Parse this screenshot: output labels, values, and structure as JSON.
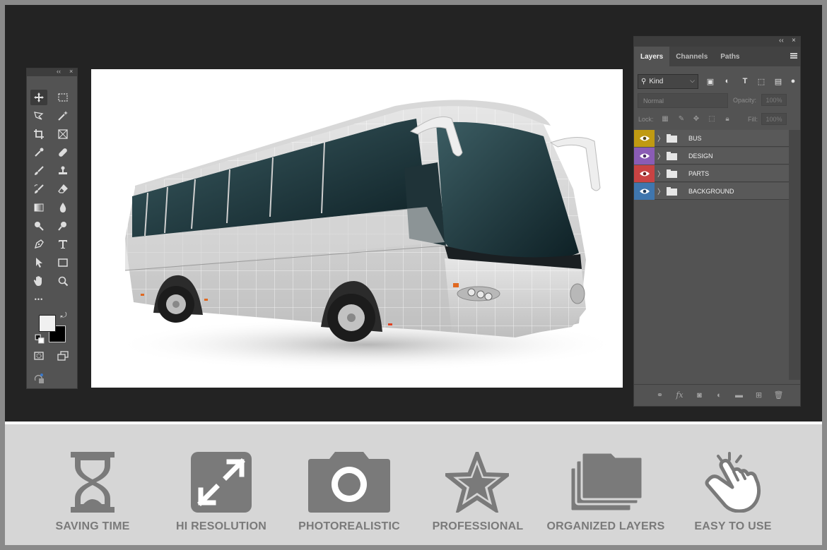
{
  "tools_panel": {
    "collapse": "‹‹",
    "close": "×",
    "more_tools": "•••",
    "icons": [
      "move-icon",
      "marquee-icon",
      "lasso-icon",
      "magic-wand-icon",
      "crop-icon",
      "frame-icon",
      "eyedropper-icon",
      "healing-brush-icon",
      "brush-icon",
      "stamp-icon",
      "history-brush-icon",
      "eraser-icon",
      "gradient-icon",
      "blur-icon",
      "dodge-icon",
      "zoom-small-icon",
      "pen-icon",
      "type-icon",
      "path-select-icon",
      "rectangle-icon",
      "hand-icon",
      "zoom-icon"
    ]
  },
  "layers_panel": {
    "collapse": "‹‹",
    "close": "×",
    "tabs": [
      {
        "label": "Layers"
      },
      {
        "label": "Channels"
      },
      {
        "label": "Paths"
      }
    ],
    "kind_label": "Kind",
    "blend_mode": "Normal",
    "opacity_label": "Opacity:",
    "opacity_value": "100%",
    "lock_label": "Lock:",
    "fill_label": "Fill:",
    "fill_value": "100%",
    "layers": [
      {
        "name": "BUS",
        "color": "#c09a12"
      },
      {
        "name": "DESIGN",
        "color": "#8a5cb5"
      },
      {
        "name": "PARTS",
        "color": "#c94343"
      },
      {
        "name": "BACKGROUND",
        "color": "#3f76ae"
      }
    ],
    "footer_icons": [
      "link-icon",
      "fx-icon",
      "mask-icon",
      "adjustment-icon",
      "group-icon",
      "new-layer-icon",
      "trash-icon"
    ]
  },
  "features": [
    {
      "label": "SAVING TIME",
      "icon": "hourglass-icon"
    },
    {
      "label": "HI RESOLUTION",
      "icon": "expand-arrows-icon"
    },
    {
      "label": "PHOTOREALISTIC",
      "icon": "camera-icon"
    },
    {
      "label": "PROFESSIONAL",
      "icon": "star-icon"
    },
    {
      "label": "ORGANIZED LAYERS",
      "icon": "layers-icon"
    },
    {
      "label": "EASY TO USE",
      "icon": "tap-hand-icon"
    }
  ],
  "colors": {
    "workspace": "#232323",
    "panel": "#535353",
    "feature_gray": "#7a7a7a",
    "feature_background": "#d6d6d6"
  }
}
